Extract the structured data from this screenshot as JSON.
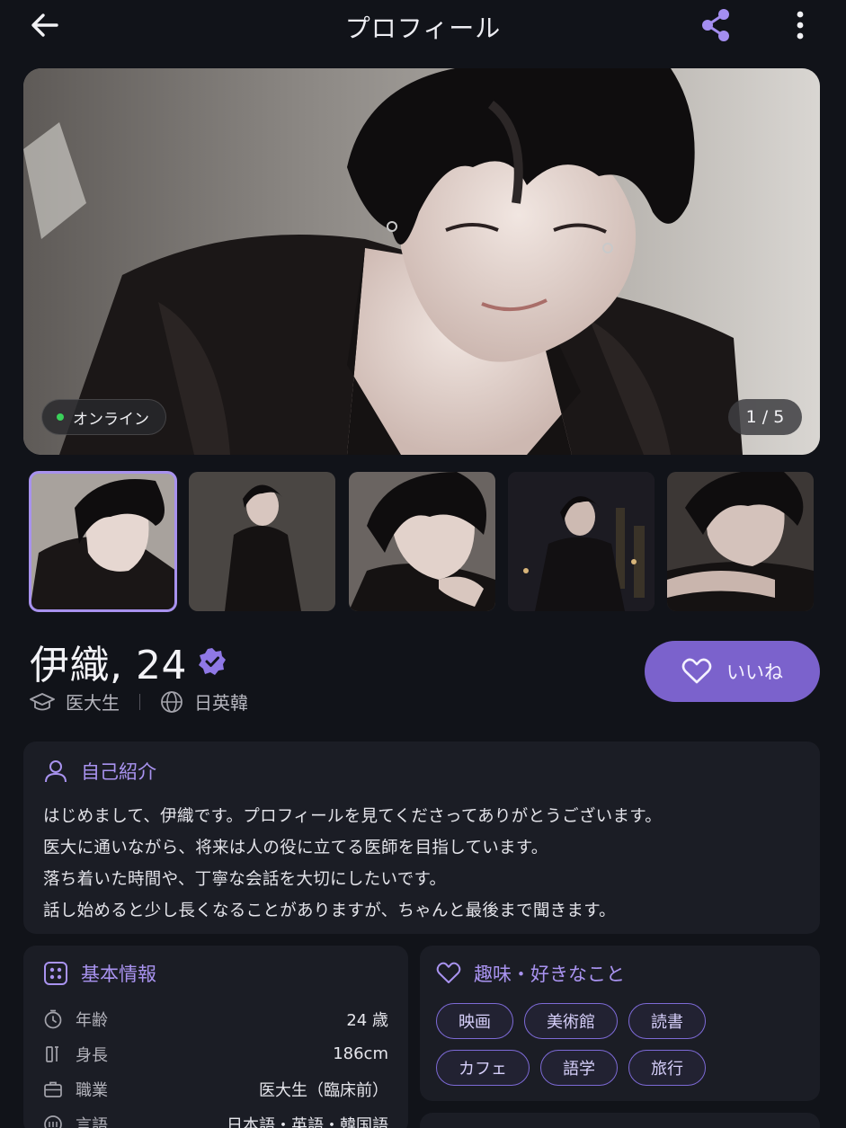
{
  "header": {
    "title": "プロフィール",
    "back_icon": "arrow-left-icon",
    "share_icon": "share-icon",
    "more_icon": "more-vertical-icon",
    "accent": "#a48ef0"
  },
  "hero": {
    "online_label": "オンライン",
    "photo_counter": "1 / 5"
  },
  "thumbnails": [
    {
      "name": "thumbnail-1",
      "selected": true
    },
    {
      "name": "thumbnail-2",
      "selected": false
    },
    {
      "name": "thumbnail-3",
      "selected": false
    },
    {
      "name": "thumbnail-4",
      "selected": false
    },
    {
      "name": "thumbnail-5",
      "selected": false
    }
  ],
  "profile": {
    "name_age": "伊織, 24",
    "verified_icon": "verified-badge-icon",
    "occupation": "医大生",
    "languages_short": "日英韓",
    "like_label": "いいね"
  },
  "intro": {
    "title": "自己紹介",
    "lines": [
      "はじめまして、伊織です。プロフィールを見てくださってありがとうございます。",
      "医大に通いながら、将来は人の役に立てる医師を目指しています。",
      "落ち着いた時間や、丁寧な会話を大切にしたいです。",
      "話し始めると少し長くなることがありますが、ちゃんと最後まで聞きます。"
    ]
  },
  "basic_info": {
    "title": "基本情報",
    "rows": [
      {
        "label": "年齢",
        "value": "24 歳",
        "icon": "clock-icon"
      },
      {
        "label": "身長",
        "value": "186cm",
        "icon": "height-icon"
      },
      {
        "label": "職業",
        "value": "医大生（臨床前）",
        "icon": "briefcase-icon"
      },
      {
        "label": "言語",
        "value": "日本語・英語・韓国語",
        "icon": "language-icon"
      }
    ]
  },
  "hobbies": {
    "title": "趣味・好きなこと",
    "tags": [
      "映画",
      "美術館",
      "読書",
      "カフェ",
      "語学",
      "旅行"
    ]
  },
  "colors": {
    "background": "#111319",
    "card": "#1b1d25",
    "accent": "#7b62cc",
    "accent_light": "#a993f0",
    "online": "#3ad15a"
  }
}
